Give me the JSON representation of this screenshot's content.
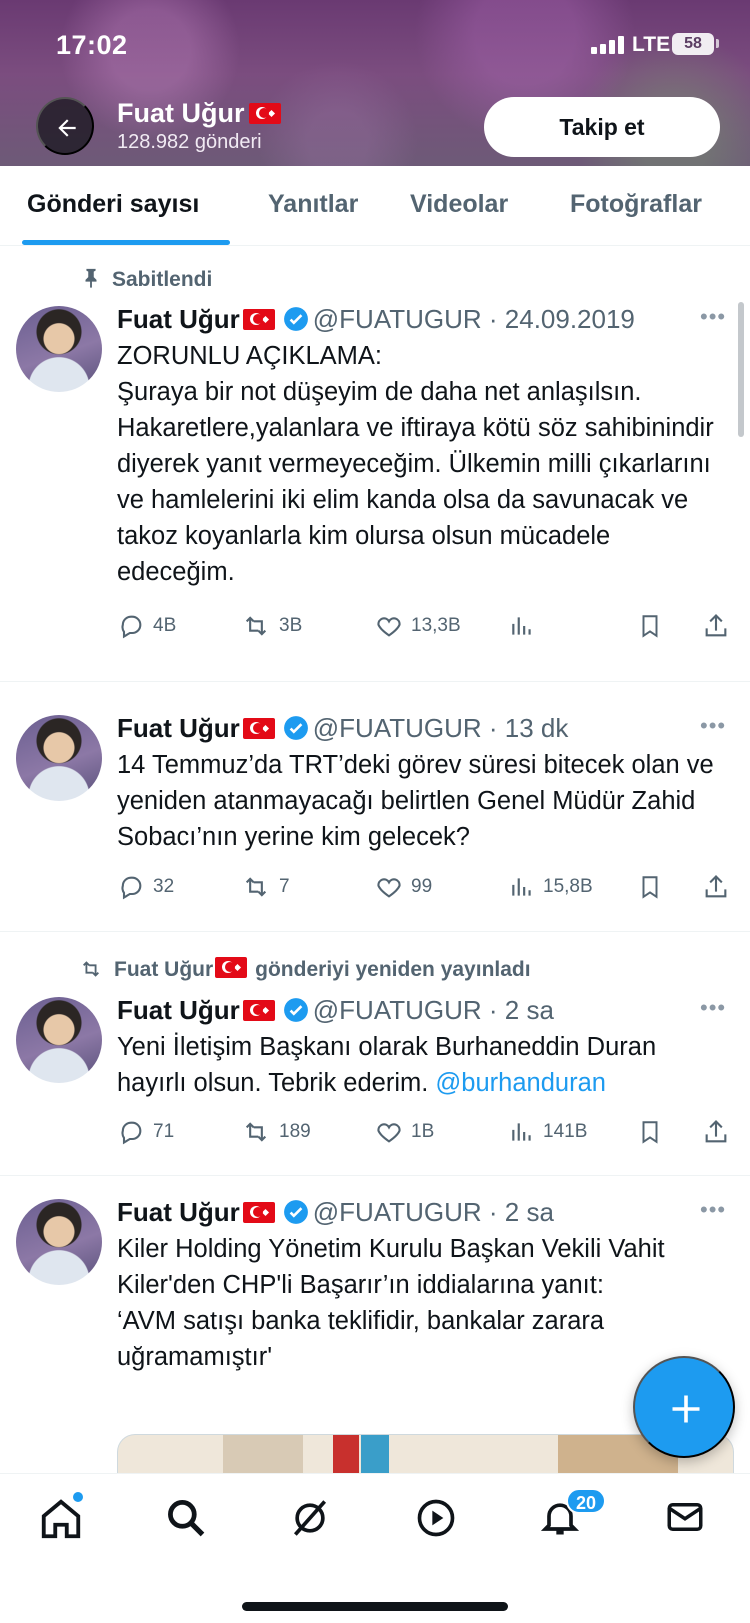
{
  "status_bar": {
    "time": "17:02",
    "network": "LTE",
    "battery": "58"
  },
  "header": {
    "name": "Fuat Uğur",
    "post_count": "128.982 gönderi",
    "follow_label": "Takip et"
  },
  "tabs": [
    "Gönderi sayısı",
    "Yanıtlar",
    "Videolar",
    "Fotoğraflar"
  ],
  "posts": [
    {
      "context": "Sabitlendi",
      "author": "Fuat Uğur",
      "handle": "@FUATUGUR · 24.09.2019",
      "text": "ZORUNLU AÇIKLAMA:\nŞuraya bir not düşeyim de daha net anlaşılsın. Hakaretlere,yalanlara ve iftiraya kötü söz sahibinindir diyerek yanıt vermeyeceğim. Ülkemin milli çıkarlarını ve hamlelerini iki elim kanda olsa da savunacak ve takoz koyanlarla kim olursa olsun mücadele edeceğim.",
      "replies": "4B",
      "reposts": "3B",
      "likes": "13,3B",
      "views": ""
    },
    {
      "author": "Fuat Uğur",
      "handle": "@FUATUGUR · 13 dk",
      "text": "14 Temmuz’da TRT’deki görev süresi bitecek olan ve yeniden atanmayacağı belirtlen Genel Müdür Zahid Sobacı’nın yerine kim gelecek?",
      "replies": "32",
      "reposts": "7",
      "likes": "99",
      "views": "15,8B"
    },
    {
      "context_name": "Fuat Uğur",
      "context_text": "gönderiyi yeniden yayınladı",
      "author": "Fuat Uğur",
      "handle": "@FUATUGUR · 2 sa",
      "text": "Yeni İletişim Başkanı olarak Burhaneddin Duran hayırlı olsun. Tebrik ederim. ",
      "mention": "@burhanduran",
      "replies": "71",
      "reposts": "189",
      "likes": "1B",
      "views": "141B"
    },
    {
      "author": "Fuat Uğur",
      "handle": "@FUATUGUR · 2 sa",
      "text": "Kiler Holding Yönetim Kurulu Başkan Vekili Vahit Kiler'den CHP'li Başarır’ın iddialarına yanıt:\n‘AVM satışı banka teklifidir, bankalar zarara uğramamıştır'"
    }
  ],
  "bottom_nav": {
    "notification_count": "20"
  },
  "colors": {
    "accent": "#1d9bf0",
    "text": "#0f1419",
    "muted": "#536471"
  }
}
